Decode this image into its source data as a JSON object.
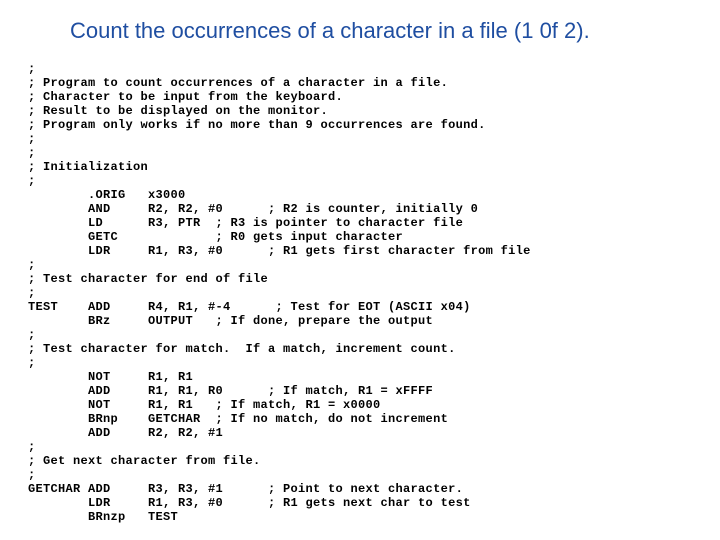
{
  "title": "Count the occurrences of a character in a file (1 0f 2).",
  "code_lines": [
    ";",
    "; Program to count occurrences of a character in a file.",
    "; Character to be input from the keyboard.",
    "; Result to be displayed on the monitor.",
    "; Program only works if no more than 9 occurrences are found.",
    ";",
    ";",
    "; Initialization",
    ";",
    "        .ORIG   x3000",
    "        AND     R2, R2, #0      ; R2 is counter, initially 0",
    "        LD      R3, PTR  ; R3 is pointer to character file",
    "        GETC             ; R0 gets input character",
    "        LDR     R1, R3, #0      ; R1 gets first character from file",
    ";",
    "; Test character for end of file",
    ";",
    "TEST    ADD     R4, R1, #-4      ; Test for EOT (ASCII x04)",
    "        BRz     OUTPUT   ; If done, prepare the output",
    ";",
    "; Test character for match.  If a match, increment count.",
    ";",
    "        NOT     R1, R1",
    "        ADD     R1, R1, R0      ; If match, R1 = xFFFF",
    "        NOT     R1, R1   ; If match, R1 = x0000",
    "        BRnp    GETCHAR  ; If no match, do not increment",
    "        ADD     R2, R2, #1",
    ";",
    "; Get next character from file.",
    ";",
    "GETCHAR ADD     R3, R3, #1      ; Point to next character.",
    "        LDR     R1, R3, #0      ; R1 gets next char to test",
    "        BRnzp   TEST"
  ]
}
